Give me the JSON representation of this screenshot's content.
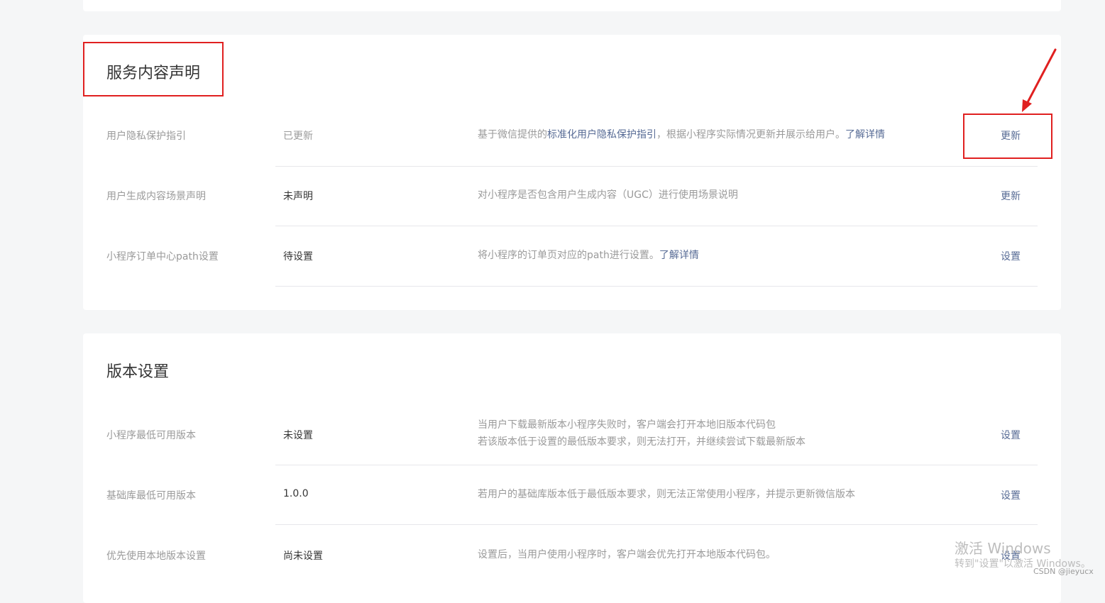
{
  "service": {
    "title": "服务内容声明",
    "rows": [
      {
        "label": "用户隐私保护指引",
        "status": "已更新",
        "desc_prefix": "基于微信提供的",
        "desc_link": "标准化用户隐私保护指引",
        "desc_suffix": "，根据小程序实际情况更新并展示给用户。",
        "desc_link2": "了解详情",
        "action": "更新"
      },
      {
        "label": "用户生成内容场景声明",
        "status": "未声明",
        "desc": "对小程序是否包含用户生成内容（UGC）进行使用场景说明",
        "action": "更新"
      },
      {
        "label": "小程序订单中心path设置",
        "status": "待设置",
        "desc_prefix": "将小程序的订单页对应的path进行设置。",
        "desc_link": "了解详情",
        "action": "设置"
      }
    ]
  },
  "version": {
    "title": "版本设置",
    "rows": [
      {
        "label": "小程序最低可用版本",
        "status": "未设置",
        "desc_line1": "当用户下载最新版本小程序失败时，客户端会打开本地旧版本代码包",
        "desc_line2": "若该版本低于设置的最低版本要求，则无法打开，并继续尝试下载最新版本",
        "action": "设置"
      },
      {
        "label": "基础库最低可用版本",
        "status": "1.0.0",
        "desc": "若用户的基础库版本低于最低版本要求，则无法正常使用小程序，并提示更新微信版本",
        "action": "设置"
      },
      {
        "label": "优先使用本地版本设置",
        "status": "尚未设置",
        "desc": "设置后，当用户使用小程序时，客户端会优先打开本地版本代码包。",
        "action": "设置"
      }
    ]
  },
  "watermark": {
    "line1": "激活 Windows",
    "line2": "转到\"设置\"以激活 Windows。",
    "credit": "CSDN @jieyucx"
  },
  "colors": {
    "link": "#576b95",
    "annotation": "#e02020",
    "background": "#f5f6f7"
  }
}
